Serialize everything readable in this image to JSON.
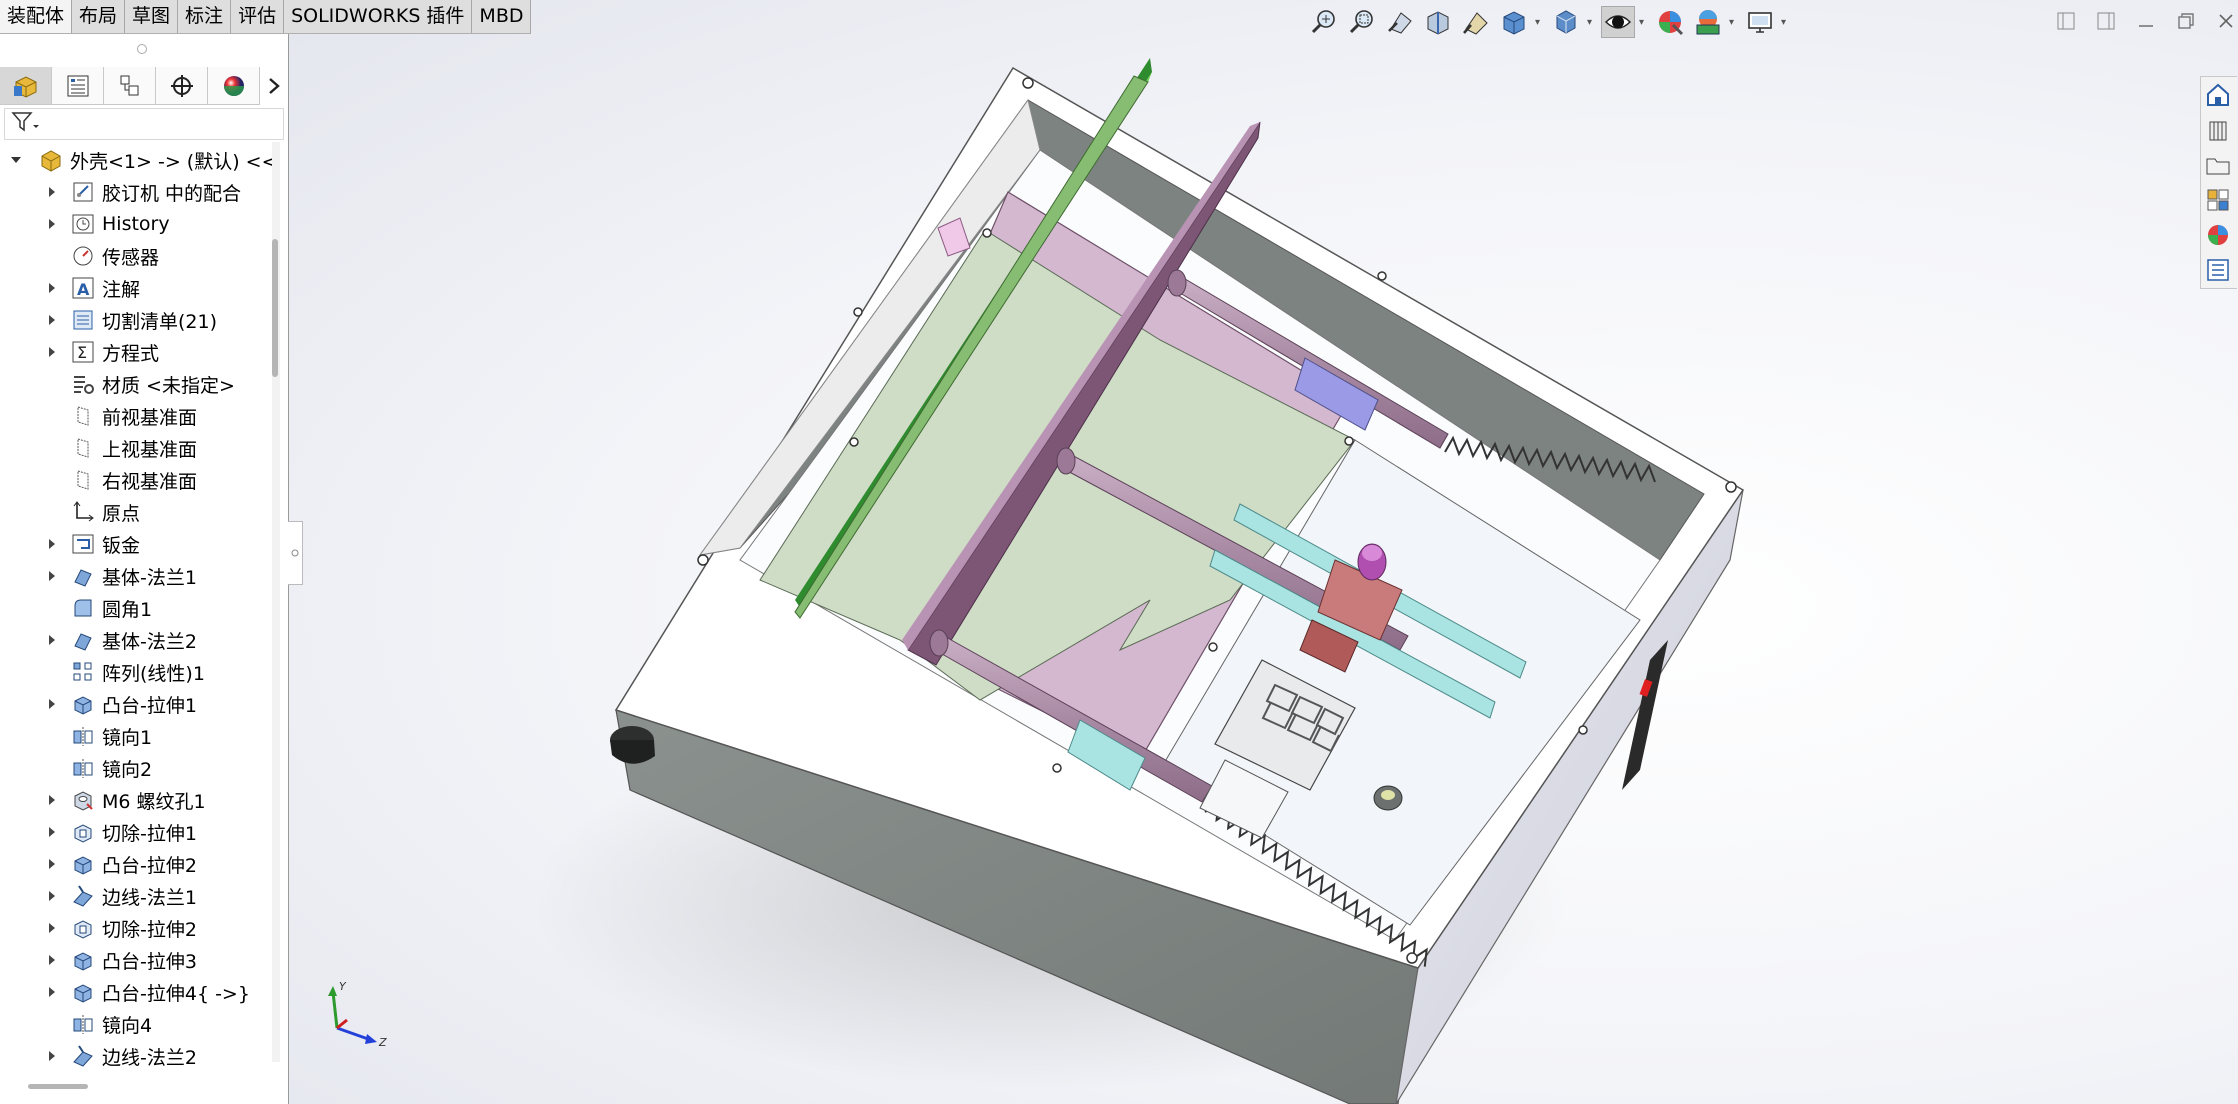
{
  "tabs": [
    {
      "label": "装配体",
      "active": true
    },
    {
      "label": "布局"
    },
    {
      "label": "草图"
    },
    {
      "label": "标注"
    },
    {
      "label": "评估"
    },
    {
      "label": "SOLIDWORKS 插件"
    },
    {
      "label": "MBD"
    }
  ],
  "panel_tabs": [
    {
      "icon": "feature-manager-icon"
    },
    {
      "icon": "property-manager-icon"
    },
    {
      "icon": "configuration-manager-icon"
    },
    {
      "icon": "dimxpert-icon"
    },
    {
      "icon": "display-manager-icon"
    }
  ],
  "tree": {
    "root": "外壳<1> -> (默认) <<​",
    "items": [
      {
        "label": "胶订机 中的配合",
        "caret": true,
        "icon": "mates-icon"
      },
      {
        "label": "History",
        "caret": true,
        "icon": "history-icon"
      },
      {
        "label": "传感器",
        "caret": false,
        "icon": "sensor-icon"
      },
      {
        "label": "注解",
        "caret": true,
        "icon": "annotation-icon"
      },
      {
        "label": "切割清单(21)",
        "caret": true,
        "icon": "cut-list-icon"
      },
      {
        "label": "方程式",
        "caret": true,
        "icon": "equation-icon"
      },
      {
        "label": "材质 <未指定>",
        "caret": false,
        "icon": "material-icon"
      },
      {
        "label": "前视基准面",
        "caret": false,
        "icon": "plane-icon"
      },
      {
        "label": "上视基准面",
        "caret": false,
        "icon": "plane-icon"
      },
      {
        "label": "右视基准面",
        "caret": false,
        "icon": "plane-icon"
      },
      {
        "label": "原点",
        "caret": false,
        "icon": "origin-icon"
      },
      {
        "label": "钣金",
        "caret": true,
        "icon": "sheet-metal-icon"
      },
      {
        "label": "基体-法兰1",
        "caret": true,
        "icon": "base-flange-icon"
      },
      {
        "label": "圆角1",
        "caret": false,
        "icon": "fillet-icon"
      },
      {
        "label": "基体-法兰2",
        "caret": true,
        "icon": "base-flange-icon"
      },
      {
        "label": "阵列(线性)1",
        "caret": false,
        "icon": "linear-pattern-icon"
      },
      {
        "label": "凸台-拉伸1",
        "caret": true,
        "icon": "boss-extrude-icon"
      },
      {
        "label": "镜向1",
        "caret": false,
        "icon": "mirror-icon"
      },
      {
        "label": "镜向2",
        "caret": false,
        "icon": "mirror-icon"
      },
      {
        "label": "M6 螺纹孔1",
        "caret": true,
        "icon": "hole-wizard-icon"
      },
      {
        "label": "切除-拉伸1",
        "caret": true,
        "icon": "cut-extrude-icon"
      },
      {
        "label": "凸台-拉伸2",
        "caret": true,
        "icon": "boss-extrude-icon"
      },
      {
        "label": "边线-法兰1",
        "caret": true,
        "icon": "edge-flange-icon"
      },
      {
        "label": "切除-拉伸2",
        "caret": true,
        "icon": "cut-extrude-icon"
      },
      {
        "label": "凸台-拉伸3",
        "caret": true,
        "icon": "boss-extrude-icon"
      },
      {
        "label": "凸台-拉伸4{ ->}",
        "caret": true,
        "icon": "boss-extrude-icon"
      },
      {
        "label": "镜向4",
        "caret": false,
        "icon": "mirror-icon"
      },
      {
        "label": "边线-法兰2",
        "caret": true,
        "icon": "edge-flange-icon"
      }
    ]
  },
  "view_toolbar": [
    {
      "icon": "zoom-to-fit-icon"
    },
    {
      "icon": "zoom-to-area-icon"
    },
    {
      "icon": "previous-view-icon"
    },
    {
      "icon": "section-view-icon"
    },
    {
      "icon": "dynamic-annotation-icon"
    },
    {
      "icon": "view-orientation-icon",
      "dropdown": true
    },
    {
      "icon": "display-style-icon",
      "dropdown": true
    },
    {
      "icon": "hide-show-icon",
      "dropdown": true,
      "active": true
    },
    {
      "icon": "edit-appearance-icon"
    },
    {
      "icon": "apply-scene-icon",
      "dropdown": true
    },
    {
      "icon": "view-settings-icon",
      "dropdown": true
    }
  ],
  "triad": {
    "y": "Y",
    "z": "Z"
  },
  "colors": {
    "housing": "#7d8380",
    "plate_green": "#cfdcc6",
    "plate_pink": "#d4b8cf",
    "rod": "#b194ad",
    "bar_cyan": "#a9e3e2",
    "slider_blue": "#9a9ae6"
  }
}
